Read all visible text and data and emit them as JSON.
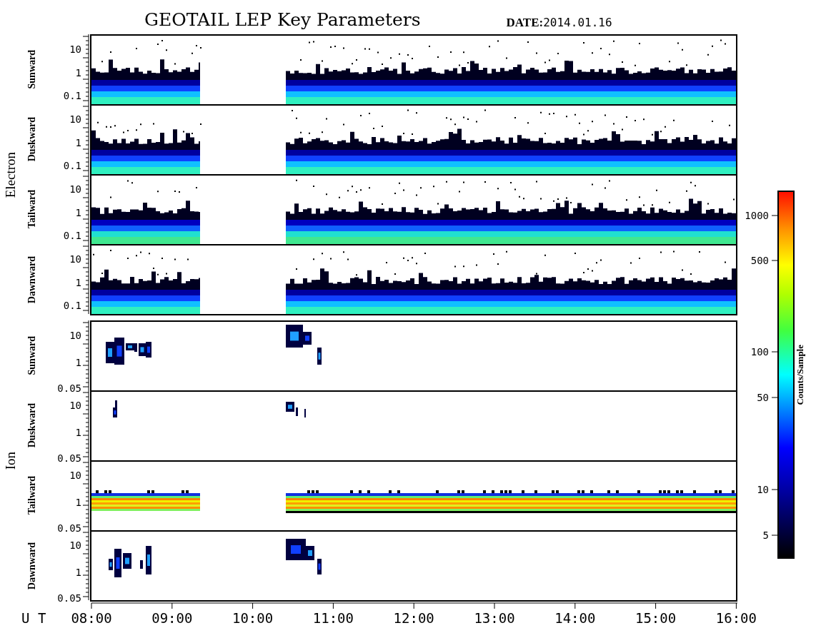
{
  "title": "GEOTAIL LEP Key Parameters",
  "date": {
    "label": "DATE:",
    "value": "2014.01.16"
  },
  "groups": [
    {
      "name": "Electron",
      "panels": [
        {
          "label": "Sunward",
          "kind": "electron",
          "y_tick_labels": [
            "10",
            "1",
            "0.1"
          ]
        },
        {
          "label": "Duskward",
          "kind": "electron",
          "y_tick_labels": [
            "10",
            "1",
            "0.1"
          ]
        },
        {
          "label": "Tailward",
          "kind": "electron",
          "y_tick_labels": [
            "10",
            "1",
            "0.1"
          ]
        },
        {
          "label": "Dawnward",
          "kind": "electron",
          "y_tick_labels": [
            "10",
            "1",
            "0.1"
          ]
        }
      ]
    },
    {
      "name": "Ion",
      "panels": [
        {
          "label": "Sunward",
          "kind": "ion_burst",
          "y_tick_labels": [
            "10",
            "1",
            "0.05"
          ]
        },
        {
          "label": "Duskward",
          "kind": "ion_sparse",
          "y_tick_labels": [
            "10",
            "1",
            "0.05"
          ]
        },
        {
          "label": "Tailward",
          "kind": "ion_band",
          "y_tick_labels": [
            "10",
            "1",
            "0.05"
          ]
        },
        {
          "label": "Dawnward",
          "kind": "ion_burst",
          "y_tick_labels": [
            "10",
            "1",
            "0.05"
          ]
        }
      ]
    }
  ],
  "x_axis": {
    "label": "U T",
    "tick_labels": [
      "08:00",
      "09:00",
      "10:00",
      "11:00",
      "12:00",
      "13:00",
      "14:00",
      "15:00",
      "16:00"
    ]
  },
  "colorbar": {
    "label": "Counts/Sample",
    "tick_labels": [
      "1000",
      "500",
      "100",
      "50",
      "10",
      "5"
    ]
  }
}
